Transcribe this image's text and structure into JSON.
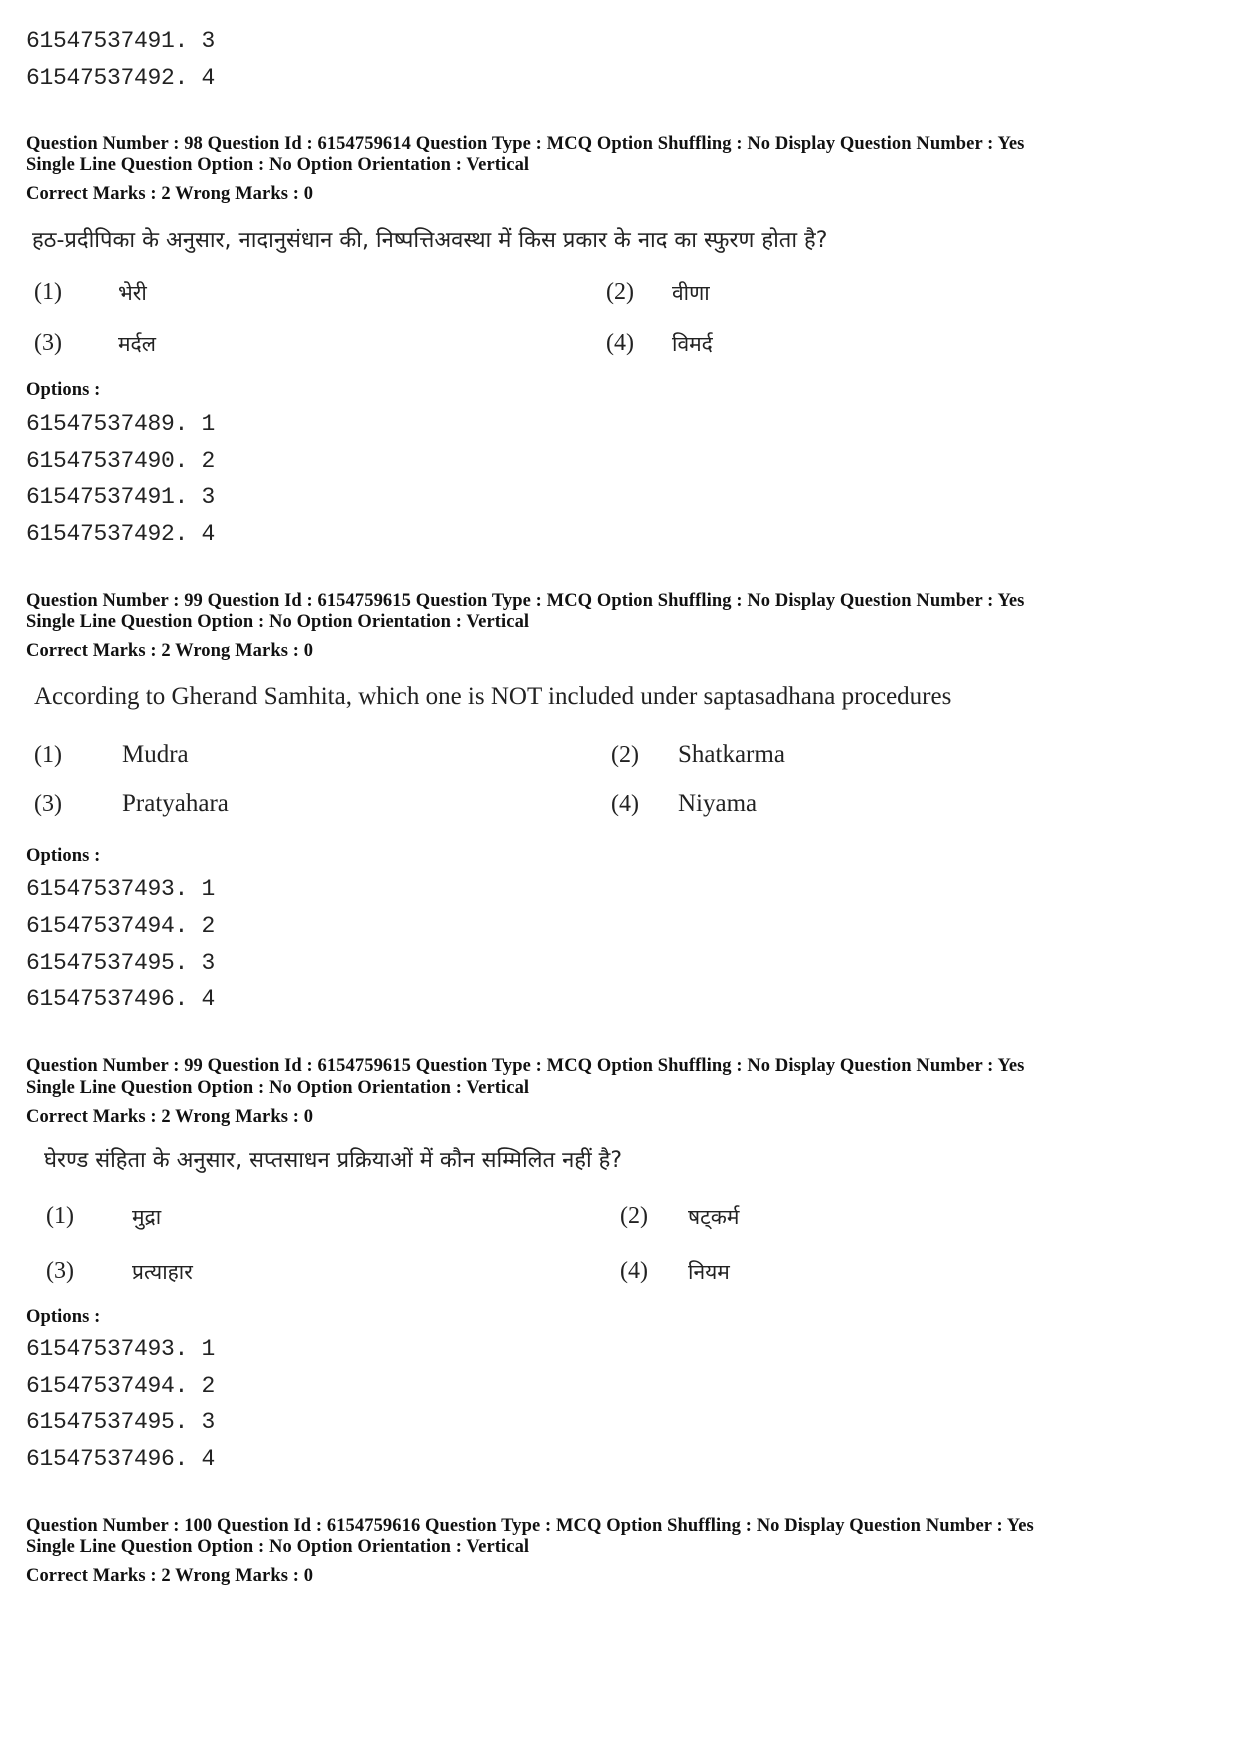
{
  "prev_tail": {
    "option_ids": [
      "61547537491. 3",
      "61547537492. 4"
    ]
  },
  "questions": [
    {
      "header_line1": "Question Number : 98  Question Id : 6154759614  Question Type : MCQ  Option Shuffling : No  Display Question Number : Yes",
      "header_line2": "Single Line Question Option : No  Option Orientation : Vertical",
      "marks": "Correct Marks : 2  Wrong Marks : 0",
      "question": "हठ-प्रदीपिका के अनुसार, नादानुसंधान की, निष्पत्तिअवस्था में किस प्रकार के नाद का स्फुरण होता है?",
      "choices": [
        {
          "num": "(1)",
          "text": "भेरी"
        },
        {
          "num": "(2)",
          "text": "वीणा"
        },
        {
          "num": "(3)",
          "text": "मर्दल"
        },
        {
          "num": "(4)",
          "text": "विमर्द"
        }
      ],
      "options_label": "Options :",
      "option_ids": [
        "61547537489. 1",
        "61547537490. 2",
        "61547537491. 3",
        "61547537492. 4"
      ]
    },
    {
      "header_line1": "Question Number : 99  Question Id : 6154759615  Question Type : MCQ  Option Shuffling : No  Display Question Number : Yes",
      "header_line2": "Single Line Question Option : No  Option Orientation : Vertical",
      "marks": "Correct Marks : 2  Wrong Marks : 0",
      "question": "According to Gherand Samhita, which one is NOT included under saptasadhana procedures",
      "choices": [
        {
          "num": "(1)",
          "text": "Mudra"
        },
        {
          "num": "(2)",
          "text": "Shatkarma"
        },
        {
          "num": "(3)",
          "text": "Pratyahara"
        },
        {
          "num": "(4)",
          "text": "Niyama"
        }
      ],
      "options_label": "Options :",
      "option_ids": [
        "61547537493. 1",
        "61547537494. 2",
        "61547537495. 3",
        "61547537496. 4"
      ]
    },
    {
      "header_line1": "Question Number : 99  Question Id : 6154759615  Question Type : MCQ  Option Shuffling : No  Display Question Number : Yes",
      "header_line2": "Single Line Question Option : No  Option Orientation : Vertical",
      "marks": "Correct Marks : 2  Wrong Marks : 0",
      "question": "घेरण्ड संहिता के अनुसार, सप्तसाधन प्रक्रियाओं में कौन सम्मिलित नहीं है?",
      "choices": [
        {
          "num": "(1)",
          "text": "मुद्रा"
        },
        {
          "num": "(2)",
          "text": "षट्कर्म"
        },
        {
          "num": "(3)",
          "text": "प्रत्याहार"
        },
        {
          "num": "(4)",
          "text": "नियम"
        }
      ],
      "options_label": "Options :",
      "option_ids": [
        "61547537493. 1",
        "61547537494. 2",
        "61547537495. 3",
        "61547537496. 4"
      ]
    },
    {
      "header_line1": "Question Number : 100  Question Id : 6154759616  Question Type : MCQ  Option Shuffling : No  Display Question Number : Yes",
      "header_line2": "Single Line Question Option : No  Option Orientation : Vertical",
      "marks": "Correct Marks : 2  Wrong Marks : 0"
    }
  ]
}
